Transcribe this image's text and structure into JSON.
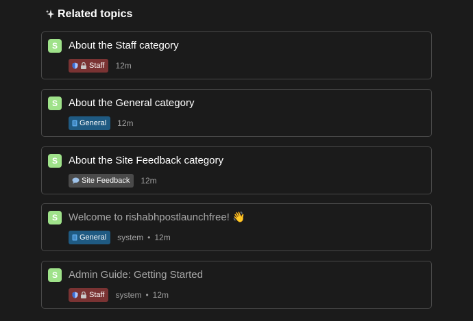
{
  "section": {
    "heading": "Related topics",
    "icon": "sparkle-icon"
  },
  "colors": {
    "staff_badge": "#7a3333",
    "general_badge": "#1f5a82",
    "feedback_badge": "#4a4a4a",
    "avatar": "#9fe28a"
  },
  "topics": [
    {
      "avatar_letter": "S",
      "title": "About the Staff category",
      "category": "Staff",
      "category_icons": [
        "shield-icon",
        "lock-icon"
      ],
      "author": "",
      "age": "12m"
    },
    {
      "avatar_letter": "S",
      "title": "About the General category",
      "category": "General",
      "category_icons": [
        "file-icon"
      ],
      "author": "",
      "age": "12m"
    },
    {
      "avatar_letter": "S",
      "title": "About the Site Feedback category",
      "category": "Site Feedback",
      "category_icons": [
        "comment-icon"
      ],
      "author": "",
      "age": "12m"
    },
    {
      "avatar_letter": "S",
      "title": "Welcome to rishabhpostlaunchfree!",
      "title_emoji": "👋",
      "category": "General",
      "category_icons": [
        "file-icon"
      ],
      "author": "system",
      "separator": "•",
      "age": "12m"
    },
    {
      "avatar_letter": "S",
      "title": "Admin Guide: Getting Started",
      "category": "Staff",
      "category_icons": [
        "shield-icon",
        "lock-icon"
      ],
      "author": "system",
      "separator": "•",
      "age": "12m"
    }
  ]
}
